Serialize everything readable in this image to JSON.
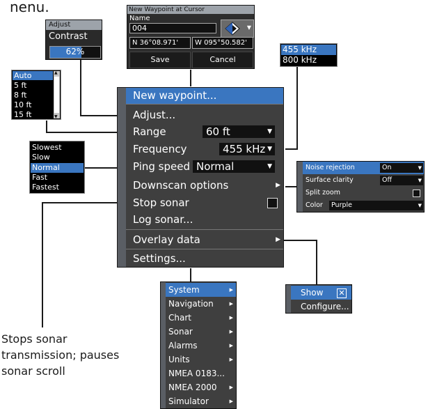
{
  "page_fragment": "nenu.",
  "waypoint_dialog": {
    "title": "New Waypoint at Cursor",
    "name_label": "Name",
    "name_value": "004",
    "latitude": "N  36°08.971'",
    "longitude": "W  095°50.582'",
    "save_label": "Save",
    "cancel_label": "Cancel"
  },
  "adjust_popup": {
    "title": "Adjust",
    "label": "Contrast",
    "value_text": "62%",
    "level_percent": 62
  },
  "range_list": {
    "items": [
      "Auto",
      "5 ft",
      "8 ft",
      "10 ft",
      "15 ft"
    ],
    "selected_index": 0
  },
  "frequency_list": {
    "items": [
      "455 kHz",
      "800 kHz"
    ],
    "selected_index": 0
  },
  "ping_speed_list": {
    "items": [
      "Slowest",
      "Slow",
      "Normal",
      "Fast",
      "Fastest"
    ],
    "selected_index": 2
  },
  "main_menu": {
    "new_waypoint": "New waypoint...",
    "adjust": "Adjust...",
    "range": {
      "label": "Range",
      "value": "60 ft"
    },
    "frequency": {
      "label": "Frequency",
      "value": "455 kHz"
    },
    "ping_speed": {
      "label": "Ping speed",
      "value": "Normal"
    },
    "downscan_options": "Downscan options",
    "stop_sonar": "Stop sonar",
    "log_sonar": "Log sonar...",
    "overlay_data": "Overlay data",
    "settings": "Settings..."
  },
  "downscan_menu": {
    "noise_rejection": {
      "label": "Noise rejection",
      "value": "On"
    },
    "surface_clarity": {
      "label": "Surface clarity",
      "value": "Off"
    },
    "split_zoom": {
      "label": "Split zoom"
    },
    "color": {
      "label": "Color",
      "value": "Purple"
    }
  },
  "settings_menu": {
    "items": [
      "System",
      "Navigation",
      "Chart",
      "Sonar",
      "Alarms",
      "Units",
      "NMEA 0183...",
      "NMEA 2000",
      "Simulator"
    ]
  },
  "overlay_menu": {
    "show_label": "Show",
    "configure_label": "Configure..."
  },
  "annotation": {
    "stop_sonar_note": "Stops sonar transmission; pauses sonar scroll"
  },
  "colors": {
    "menu_bg": "#3f3f3f",
    "highlight": "#3a76c0",
    "gutter": "#5a5e64",
    "title_bar": "#9da3aa"
  }
}
